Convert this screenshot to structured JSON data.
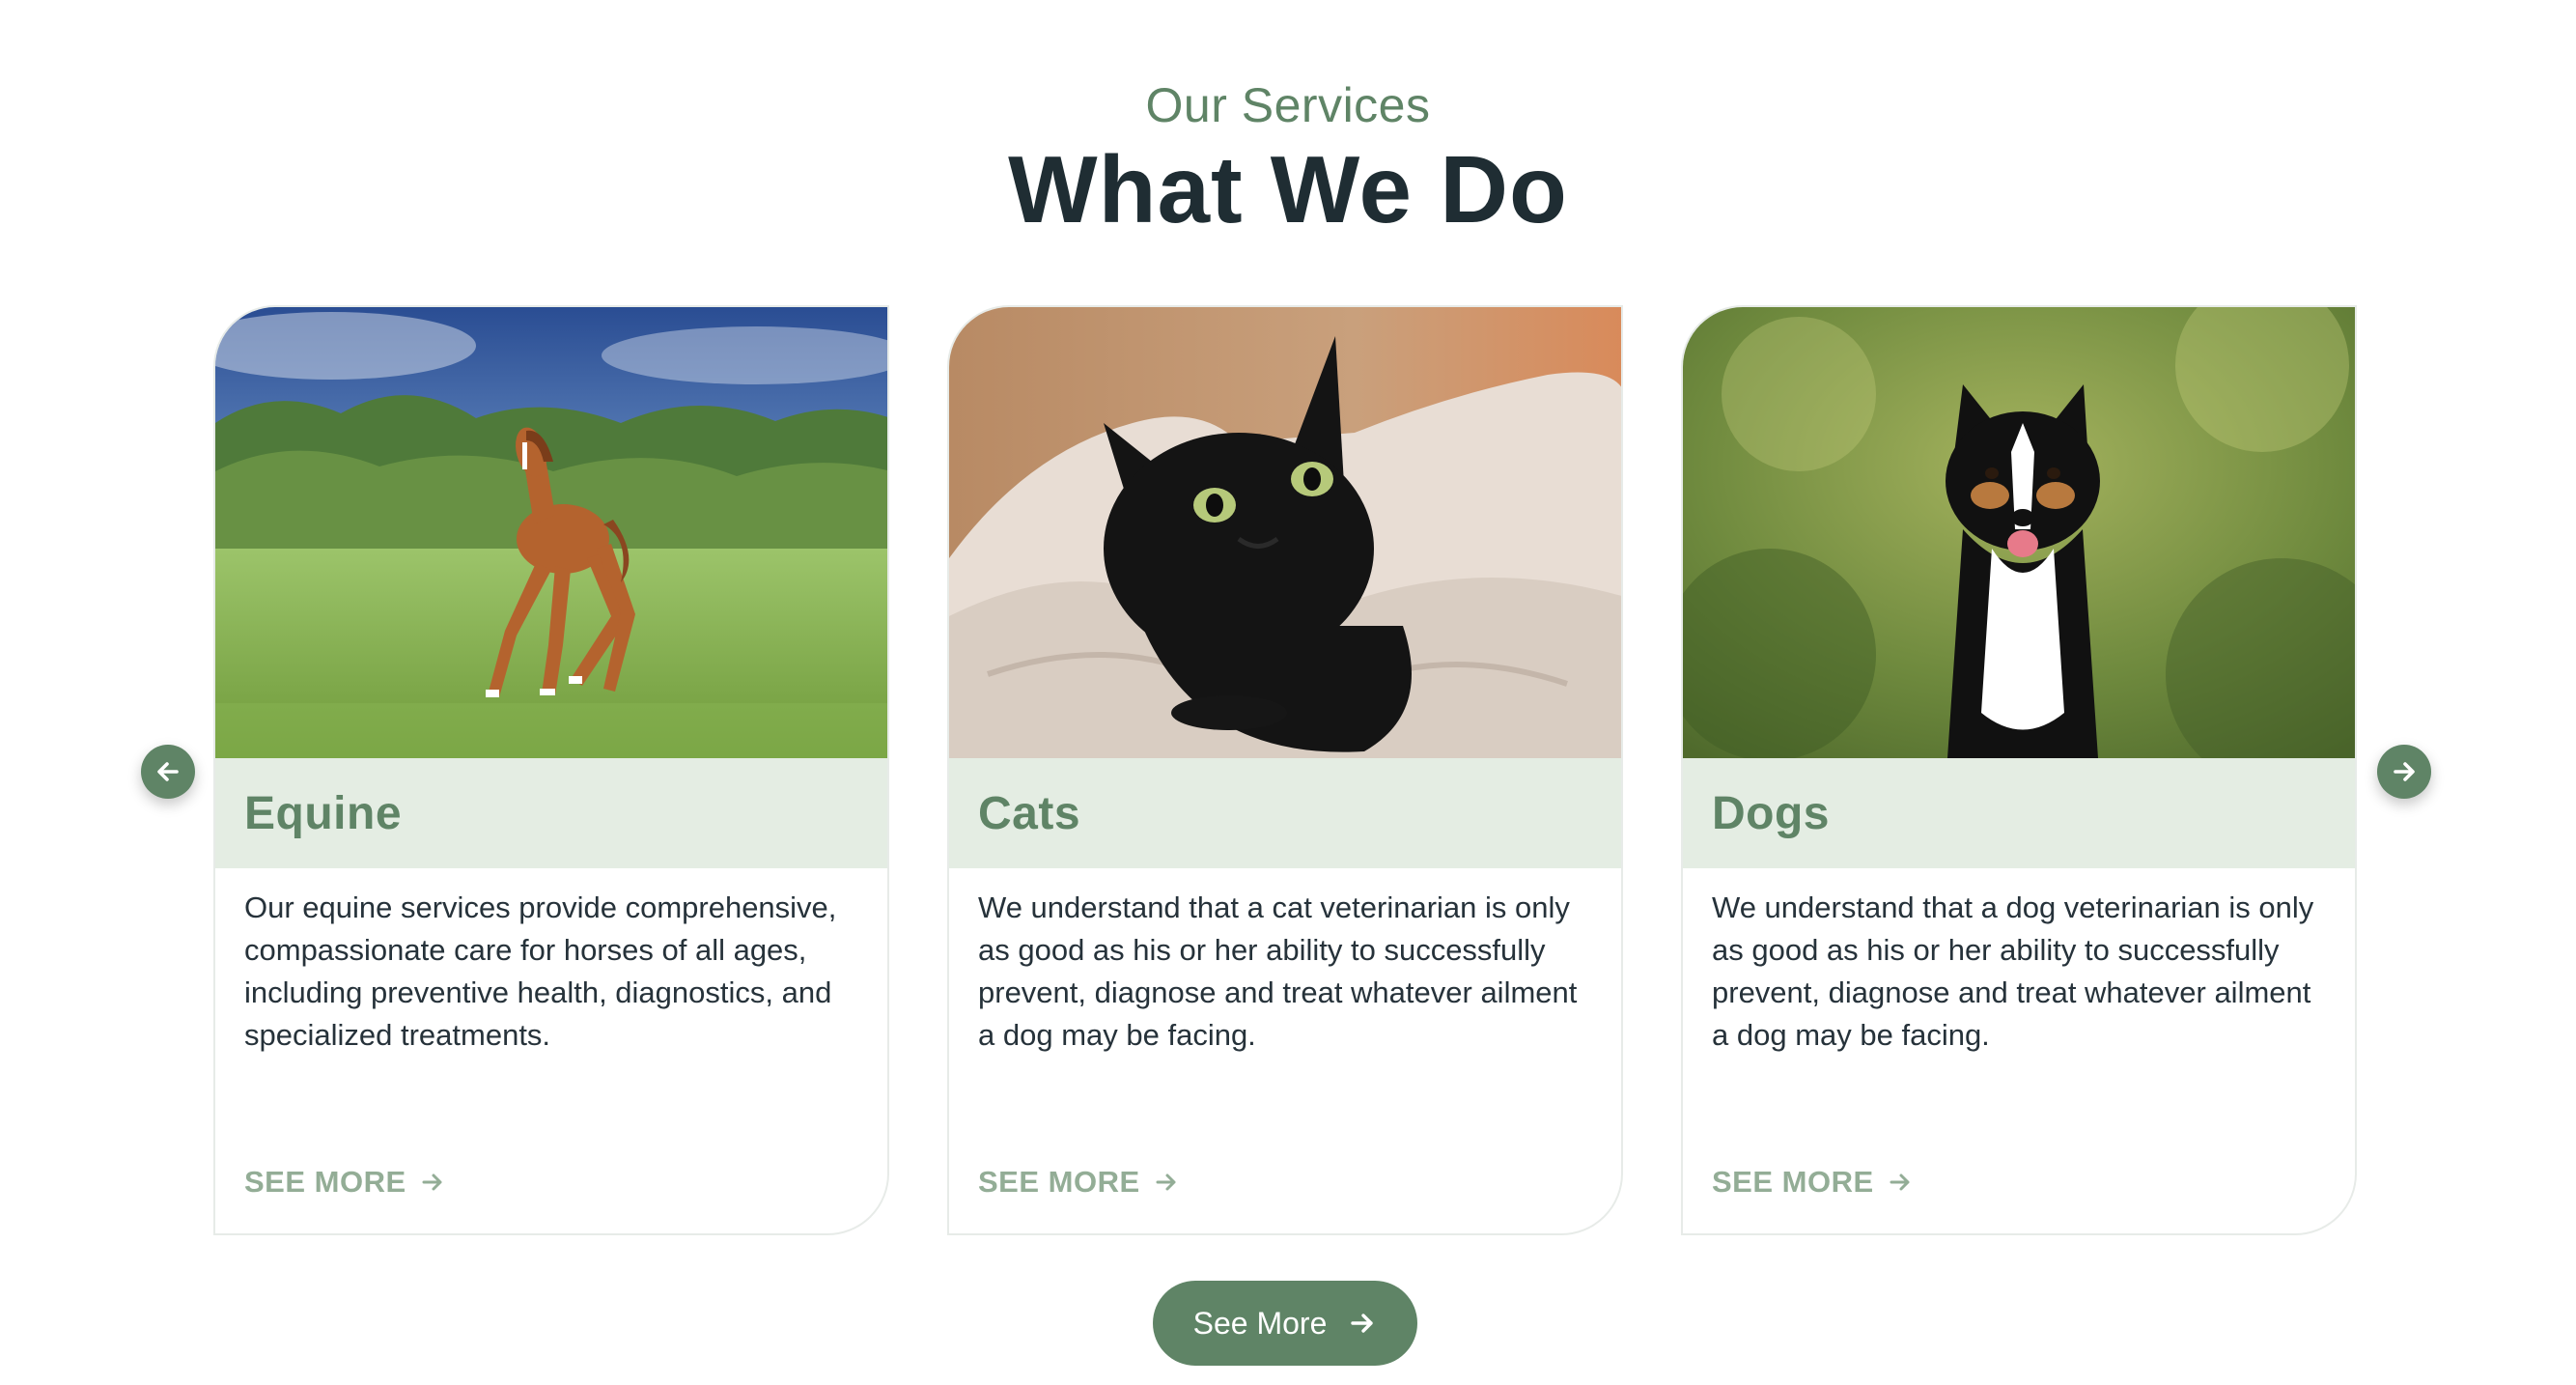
{
  "section": {
    "eyebrow": "Our Services",
    "heading": "What We Do"
  },
  "cards": [
    {
      "title": "Equine",
      "description": "Our equine services provide comprehensive, compassionate care for horses of all ages, including preventive health, diagnostics, and specialized treatments.",
      "link_label": "SEE MORE",
      "image_subject": "horse galloping in a green field"
    },
    {
      "title": "Cats",
      "description": "We understand that a cat veterinarian is only as good as his or her ability to successfully prevent, diagnose and treat whatever ailment a dog may be facing.",
      "link_label": "SEE MORE",
      "image_subject": "black cat under a blanket"
    },
    {
      "title": "Dogs",
      "description": "We understand that a dog veterinarian is only as good as his or her ability to successfully prevent, diagnose and treat whatever ailment a dog may be facing.",
      "link_label": "SEE MORE",
      "image_subject": "border collie sitting in greenery"
    }
  ],
  "carousel": {
    "prev_icon": "arrow-left-icon",
    "next_icon": "arrow-right-icon"
  },
  "cta": {
    "label": "See More",
    "icon": "arrow-right-icon"
  },
  "colors": {
    "accent": "#5f8466",
    "title_band": "#e4ede3",
    "heading": "#1f2d33",
    "body_text": "#26323a",
    "link": "#93ad96"
  }
}
